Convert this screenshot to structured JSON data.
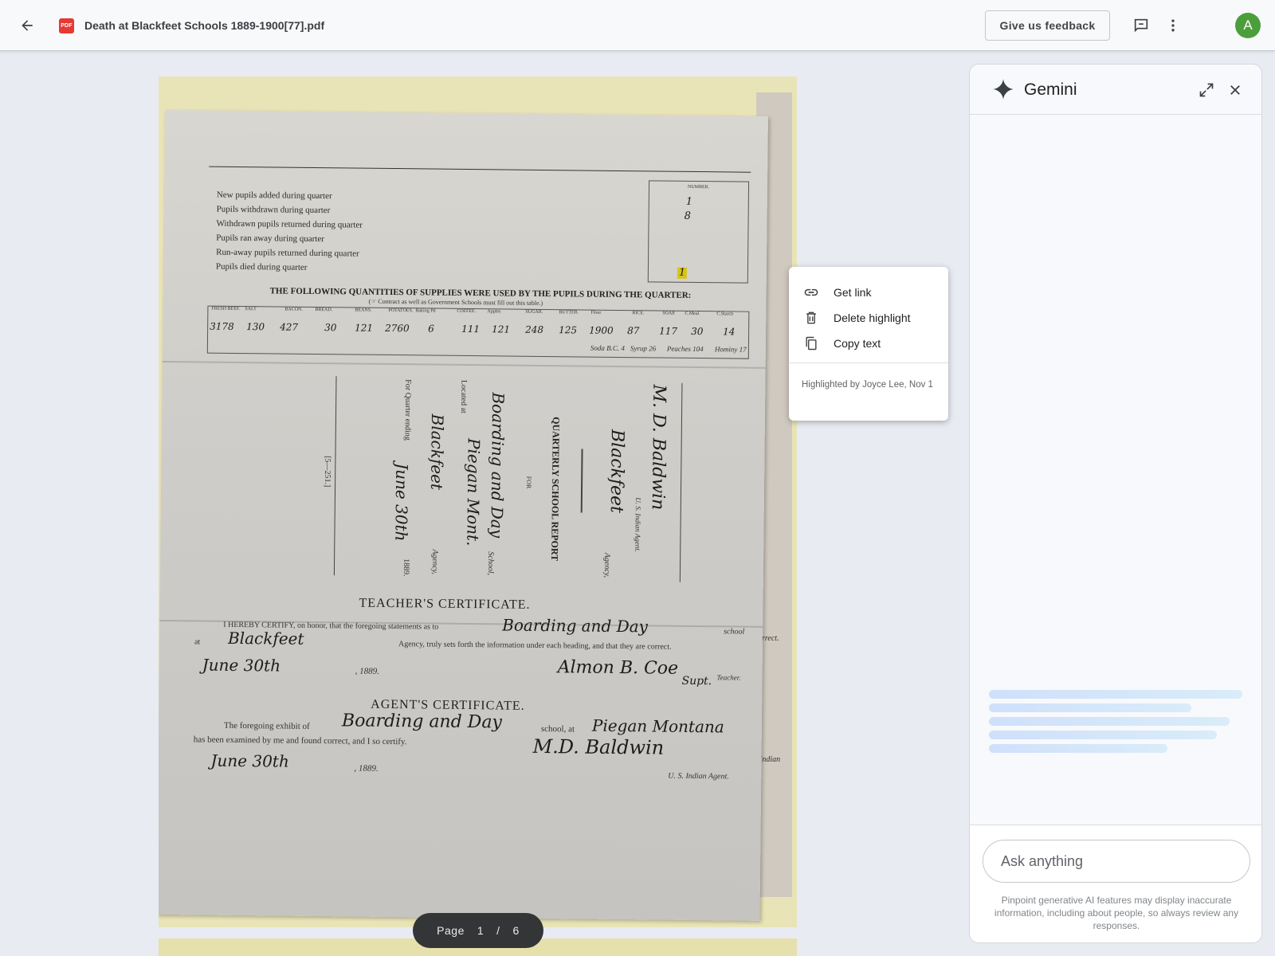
{
  "topbar": {
    "back_icon": "arrow-left-icon",
    "file_badge": "PDF",
    "document_title": "Death at Blackfeet Schools 1889-1900[77].pdf",
    "feedback_label": "Give us feedback",
    "avatar_initial": "A",
    "avatar_color": "#4b9e3a"
  },
  "document": {
    "form_rows": [
      "New pupils added during quarter",
      "Pupils withdrawn during quarter",
      "Withdrawn pupils returned during quarter",
      "Pupils ran away during quarter",
      "Run-away pupils returned during quarter",
      "Pupils died during quarter"
    ],
    "number_header": "NUMBER.",
    "number_values": [
      "1",
      "8",
      "",
      "",
      "",
      "1"
    ],
    "supplies_heading": "THE FOLLOWING QUANTITIES OF SUPPLIES WERE USED BY THE PUPILS DURING THE QUARTER:",
    "supplies_note": "(☞ Contract as well as Government Schools must fill out this table.)",
    "supplies": [
      {
        "header": "FRESH BEEF.",
        "value": "3178"
      },
      {
        "header": "SALT",
        "value": "130"
      },
      {
        "header": "BACON.",
        "value": "427"
      },
      {
        "header": "BREAD.",
        "value": "30"
      },
      {
        "header": "BEANS.",
        "value": "121"
      },
      {
        "header": "POTATOES.",
        "value": "2760"
      },
      {
        "header": "Baking Pd",
        "value": "6"
      },
      {
        "header": "COFFEE.",
        "value": "111"
      },
      {
        "header": "Apples",
        "value": "121"
      },
      {
        "header": "SUGAR.",
        "value": "248"
      },
      {
        "header": "BUTTER.",
        "value": "125"
      },
      {
        "header": "Flour",
        "value": "1900"
      },
      {
        "header": "RICE.",
        "value": "87"
      },
      {
        "header": "SOAP.",
        "value": "117"
      },
      {
        "header": "C.Meal",
        "value": "30"
      },
      {
        "header": "C.Starch",
        "value": "14"
      }
    ],
    "supplies_extra": [
      "Soda B.C. 4",
      "Syrup 26",
      "Peaches 104",
      "Hominy 17"
    ],
    "report_title": "QUARTERLY SCHOOL REPORT",
    "report_for": "FOR",
    "school_label": "School,",
    "located_label": "Located at",
    "agency_label": "Agency,",
    "quarter_label": "For Quarter ending",
    "agent_label": "U. S. Indian Agent.",
    "form_number": "[5—251.]",
    "agent_name_hand": "M. D. Baldwin",
    "agency_hand": "Blackfeet",
    "school_hand": "Boarding and Day",
    "location_hand": "Piegan Mont.",
    "quarter_hand": "June 30th",
    "year": "1889.",
    "teacher_cert_title": "TEACHER'S CERTIFICATE.",
    "teacher_cert_line1": "I HEREBY CERTIFY, on honor, that the foregoing statements as to",
    "teacher_cert_school": "school",
    "teacher_cert_at": "at",
    "teacher_cert_line2": "Agency, truly sets forth the information under each heading, and that they are correct.",
    "teacher_date": "June 30th",
    "teacher_year": ", 1889.",
    "teacher_sig": "Almon B. Coe",
    "teacher_title_hand": "Supt.",
    "teacher_label": "Teacher.",
    "agent_cert_title": "AGENT'S CERTIFICATE.",
    "agent_cert_line1": "The foregoing exhibit of",
    "agent_cert_school": "school, at",
    "agent_cert_location_hand": "Piegan Montana",
    "agent_cert_line2": "has been examined by me and found correct, and I so certify.",
    "agent_date": "June 30th",
    "agent_year": ", 1889.",
    "agent_sig": "M.D. Baldwin",
    "agent_sig_label": "U. S. Indian Agent.",
    "side_strip_text": [
      "orrect.",
      "Indian",
      "Teacher."
    ],
    "highlight_color": "#d6c51a"
  },
  "pager": {
    "label": "Page",
    "current": "1",
    "separator": "/",
    "total": "6"
  },
  "context_menu": {
    "items": [
      {
        "label": "Get link",
        "icon": "link-icon"
      },
      {
        "label": "Delete highlight",
        "icon": "trash-icon"
      },
      {
        "label": "Copy text",
        "icon": "copy-icon"
      }
    ],
    "meta": "Highlighted by Joyce Lee, Nov 1"
  },
  "gemini": {
    "title": "Gemini",
    "sparkle_icon": "gemini-sparkle-icon",
    "expand_icon": "expand-icon",
    "close_icon": "close-icon",
    "input_placeholder": "Ask anything",
    "disclaimer": "Pinpoint generative AI features may display inaccurate information, including about people, so always review any responses."
  }
}
